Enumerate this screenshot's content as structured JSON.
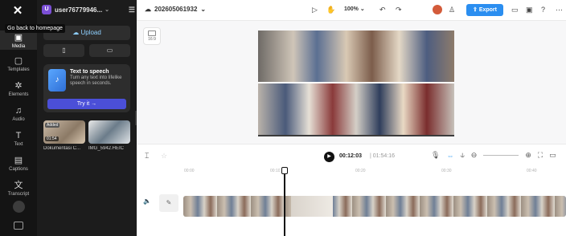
{
  "rail": {
    "tooltip": "Go back to homepage",
    "items": [
      {
        "label": "Media",
        "icon": "media-icon",
        "glyph": "▣"
      },
      {
        "label": "Templates",
        "icon": "templates-icon",
        "glyph": "▢"
      },
      {
        "label": "Elements",
        "icon": "elements-icon",
        "glyph": "✲"
      },
      {
        "label": "Audio",
        "icon": "audio-icon",
        "glyph": "♫"
      },
      {
        "label": "Text",
        "icon": "text-icon",
        "glyph": "T"
      },
      {
        "label": "Captions",
        "icon": "captions-icon",
        "glyph": "▤"
      },
      {
        "label": "Transcript",
        "icon": "transcript-icon",
        "glyph": "文"
      }
    ]
  },
  "panel": {
    "username": "user76779946...",
    "user_initial": "U",
    "upload_label": "Upload",
    "tts": {
      "title": "Text to speech",
      "description": "Turn any text into lifelike speech in seconds.",
      "button": "Try it →"
    },
    "media": [
      {
        "name": "Dokumentasi C...",
        "badge": "Added",
        "duration": "01:54"
      },
      {
        "name": "IMG_5942.HEIC"
      }
    ]
  },
  "topbar": {
    "project_name": "202605061932",
    "zoom": "100%",
    "export_label": "Export"
  },
  "canvas": {
    "ratio_label": "16:9"
  },
  "timeline": {
    "current_time": "00:12:03",
    "total_time": "01:54:16",
    "ticks": [
      "00:00",
      "00:10",
      "00:20",
      "00:30",
      "00:40"
    ]
  },
  "colors": {
    "accent": "#2b8ef0",
    "tts_button": "#4b4fd8",
    "panel_bg": "#1c1c1c"
  }
}
